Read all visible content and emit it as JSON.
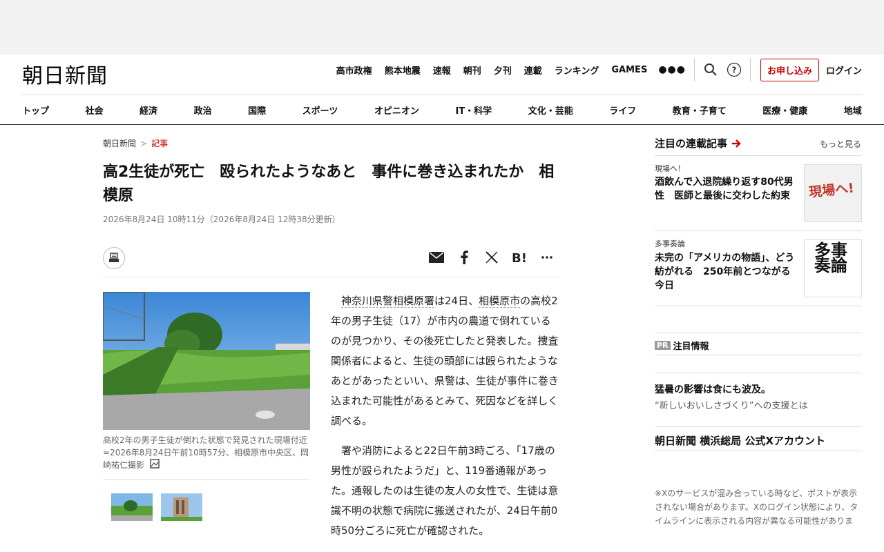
{
  "header": {
    "logo": "朝日新聞",
    "top_links": [
      "高市政権",
      "熊本地震",
      "速報",
      "朝刊",
      "夕刊",
      "連載",
      "ランキング",
      "GAMES"
    ],
    "subscribe": "お申し込み",
    "login": "ログイン",
    "icons": [
      "more-icon",
      "search-icon",
      "help-icon"
    ]
  },
  "categories": [
    "トップ",
    "社会",
    "経済",
    "政治",
    "国際",
    "スポーツ",
    "オピニオン",
    "IT・科学",
    "文化・芸能",
    "ライフ",
    "教育・子育て",
    "医療・健康",
    "地域"
  ],
  "breadcrumb": {
    "home": "朝日新聞",
    "sep": ">",
    "current": "記事"
  },
  "article": {
    "headline": "高2生徒が死亡　殴られたようなあと　事件に巻き込まれたか　相模原",
    "dateline": "2026年8月24日 10時11分（2026年8月24日 12時38分更新）",
    "photo_caption": "高校2年の男子生徒が倒れた状態で発見された現場付近=2026年8月24日午前10時57分、相模原市中央区、岡崎祐仁撮影",
    "body_p1_link1": "神奈川県警相模原署",
    "body_p1_a": "は24日、",
    "body_p1_link2": "相模原市",
    "body_p1_b": "の高校2年の男子生徒（17）が市内の農道で倒れているのが見つかり、その後死亡したと発表した。捜査関係者によると、生徒の頭部には殴られたようなあとがあったといい、県警は、生徒が事件に巻き込まれた可能性があるとみて、死因などを詳しく調べる。",
    "body_p2": "署や消防によると22日午前3時ごろ、「17歳の男性が殴られたようだ」と、119番通報があった。通報したのは生徒の友人の女性で、生徒は意識不明の状態で病院に搬送されたが、24日午前0時50分ごろに死亡が確認された。"
  },
  "sidebar": {
    "title": "注目の連載記事",
    "more": "もっと見る",
    "cards": [
      {
        "label": "現場へ！",
        "title": "酒飲んで入退院繰り返す80代男性　医師と最後に交わした約束",
        "image_text": "現場へ!"
      },
      {
        "label": "多事奏論",
        "title": "未完の「アメリカの物語」、どう紡がれる　250年前とつながる今日",
        "image_text": "多事奏論"
      }
    ],
    "pr_badge": "PR",
    "pr_label": "注目情報",
    "promo_title": "猛暑の影響は食にも波及。",
    "promo_sub": "“新しいおいしさづくり”への支援とは",
    "x_title": "朝日新聞 横浜総局 公式Xアカウント",
    "x_note": "※Xのサービスが混み合っている時など、ポストが表示されない場合があります。Xのログイン状態により、タイムラインに表示される内容が異なる可能性があります。"
  }
}
